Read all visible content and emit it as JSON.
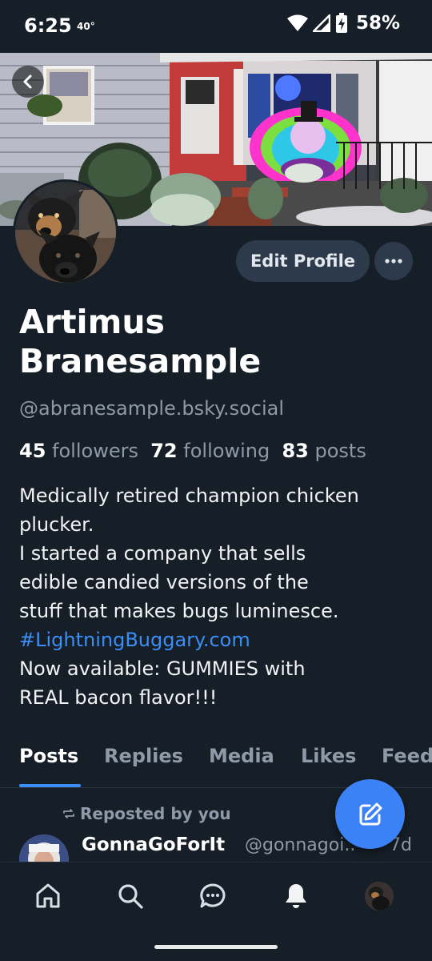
{
  "status_bar": {
    "time": "6:25",
    "temperature": "40°",
    "battery": "58%"
  },
  "profile": {
    "display_name": "Artimus Branesample",
    "handle": "@abranesample.bsky.social",
    "edit_profile_label": "Edit Profile",
    "stats": {
      "followers_count": "45",
      "followers_label": "followers",
      "following_count": "72",
      "following_label": "following",
      "posts_count": "83",
      "posts_label": "posts"
    },
    "bio_lines": [
      "Medically retired champion chicken",
      "plucker.",
      "I started a company that sells",
      "edible candied versions of the",
      "stuff that makes bugs luminesce."
    ],
    "bio_link": "#LightningBuggary.com",
    "bio_lines_after": [
      "Now available:  GUMMIES with",
      "REAL bacon flavor!!!"
    ]
  },
  "tabs": [
    "Posts",
    "Replies",
    "Media",
    "Likes",
    "Feeds"
  ],
  "active_tab": "Posts",
  "feed": {
    "repost_label": "Reposted by you",
    "author": "GonnaGoForIt",
    "author_handle": "@gonnagoi..",
    "time": "7d"
  },
  "icons": {
    "back": "chevron-left-icon",
    "more": "ellipsis-icon",
    "compose": "compose-icon",
    "nav": [
      "home-icon",
      "search-icon",
      "chat-icon",
      "bell-icon",
      "profile-avatar"
    ]
  },
  "colors": {
    "background": "#161e27",
    "accent": "#3b8ef5",
    "muted": "#8e9aa8",
    "button": "#2c3a4b"
  }
}
